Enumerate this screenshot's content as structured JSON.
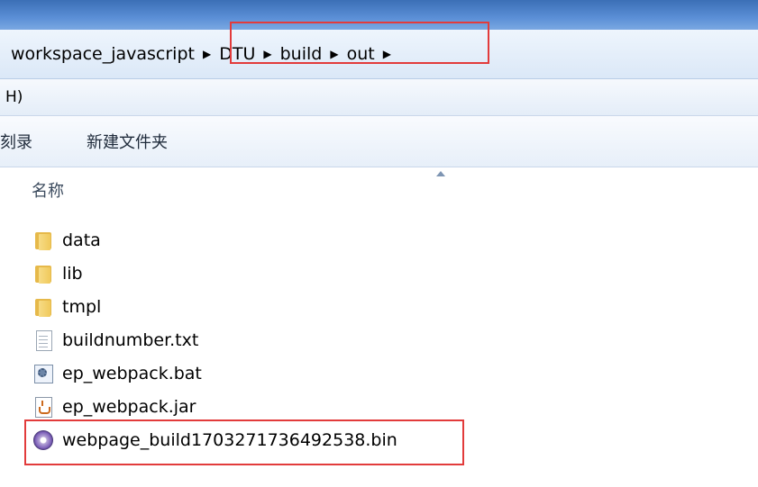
{
  "address": {
    "crumbs": [
      "workspace_javascript",
      "DTU",
      "build",
      "out"
    ],
    "separator": "▶"
  },
  "menubar": {
    "item": "H)"
  },
  "toolbar": {
    "burn_label": "刻录",
    "new_folder_label": "新建文件夹"
  },
  "list": {
    "column_header": "名称",
    "items": [
      {
        "name": "data",
        "icon": "folder-icon"
      },
      {
        "name": "lib",
        "icon": "folder-icon"
      },
      {
        "name": "tmpl",
        "icon": "folder-icon"
      },
      {
        "name": "buildnumber.txt",
        "icon": "text-file-icon"
      },
      {
        "name": "ep_webpack.bat",
        "icon": "batch-file-icon"
      },
      {
        "name": "ep_webpack.jar",
        "icon": "jar-file-icon"
      },
      {
        "name": "webpage_build1703271736492538.bin",
        "icon": "bin-file-icon"
      }
    ]
  },
  "colors": {
    "highlight": "#e23b3b",
    "titlebar": "#3b6fb6"
  }
}
